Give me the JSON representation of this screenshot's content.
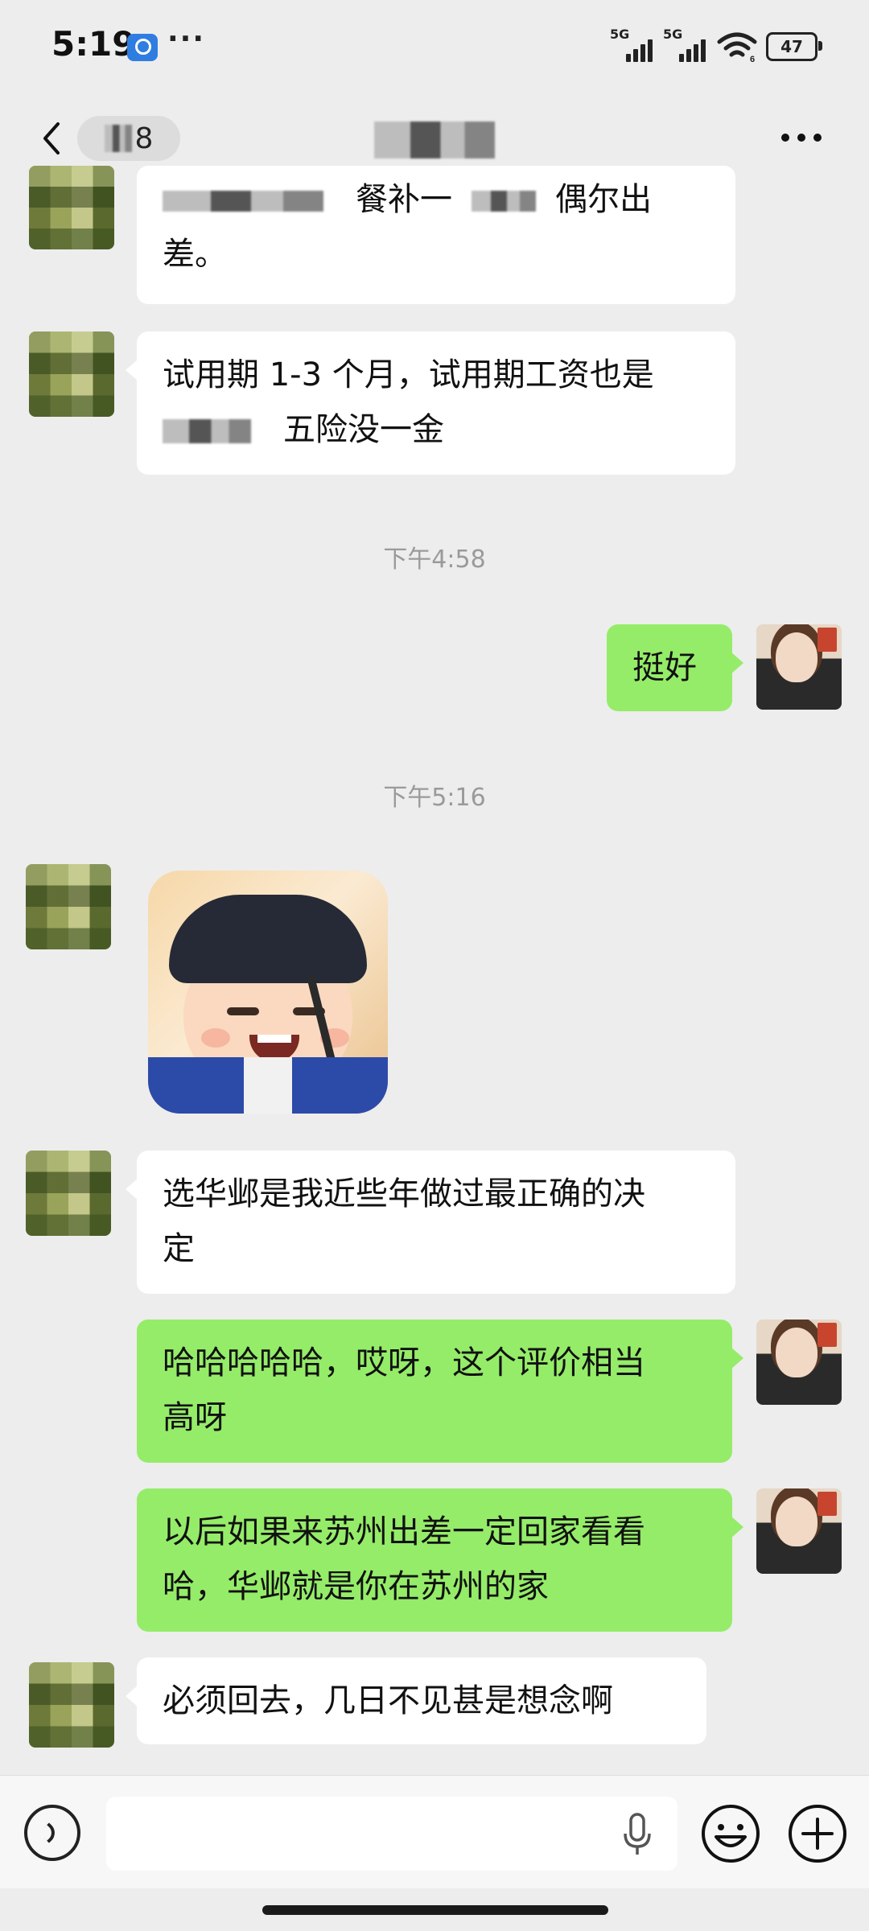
{
  "status_bar": {
    "time": "5:19",
    "app_icon": "ai-app-icon",
    "more_dots": "···",
    "signal1_label": "5G",
    "signal2_label": "5G",
    "wifi_badge": "6",
    "battery": "47"
  },
  "header": {
    "unread_count": "8",
    "back_icon": "chevron-left-icon",
    "more_icon": "more-horizontal-icon"
  },
  "messages": [
    {
      "side": "left",
      "text": "餐补一天 偶尔出差。"
    },
    {
      "side": "left",
      "text": "试用期 1-3 个月，试用期工资也是 五险没一金"
    },
    {
      "side": "divider",
      "text": "下午4:58"
    },
    {
      "side": "right",
      "text": "挺好"
    },
    {
      "side": "divider",
      "text": "下午5:16"
    },
    {
      "side": "left",
      "type": "sticker",
      "text": ""
    },
    {
      "side": "left",
      "text": "选华邺是我近些年做过最正确的决定"
    },
    {
      "side": "right",
      "text": "哈哈哈哈哈，哎呀，这个评价相当高呀"
    },
    {
      "side": "right",
      "text": "以后如果来苏州出差一定回家看看哈，华邺就是你在苏州的家"
    },
    {
      "side": "left",
      "text": "必须回去，几日不见甚是想念啊"
    }
  ],
  "msg_lines": {
    "m0_line1a": "餐补一",
    "m0_line1b": "偶尔出",
    "m0_line2": "差。",
    "m1_line1": "试用期 1-3 个月，试用期工资也是",
    "m1_line2": "五险没一金",
    "m3": "挺好",
    "m6_line1": "选华邺是我近些年做过最正确的决",
    "m6_line2": "定",
    "m7_line1": "哈哈哈哈哈，哎呀，这个评价相当",
    "m7_line2": "高呀",
    "m8_line1": "以后如果来苏州出差一定回家看看",
    "m8_line2": "哈，华邺就是你在苏州的家",
    "m9": "必须回去，几日不见甚是想念啊",
    "t1": "下午4:58",
    "t2": "下午5:16"
  },
  "input_bar": {
    "voice_icon": "voice-toggle-icon",
    "mic_icon": "microphone-icon",
    "emoji_icon": "emoji-icon",
    "plus_icon": "plus-icon",
    "text_value": ""
  },
  "colors": {
    "chat_bg": "#ededed",
    "bubble_self": "#95ec69",
    "bubble_other": "#ffffff",
    "timestamp": "#9a9a9a"
  }
}
